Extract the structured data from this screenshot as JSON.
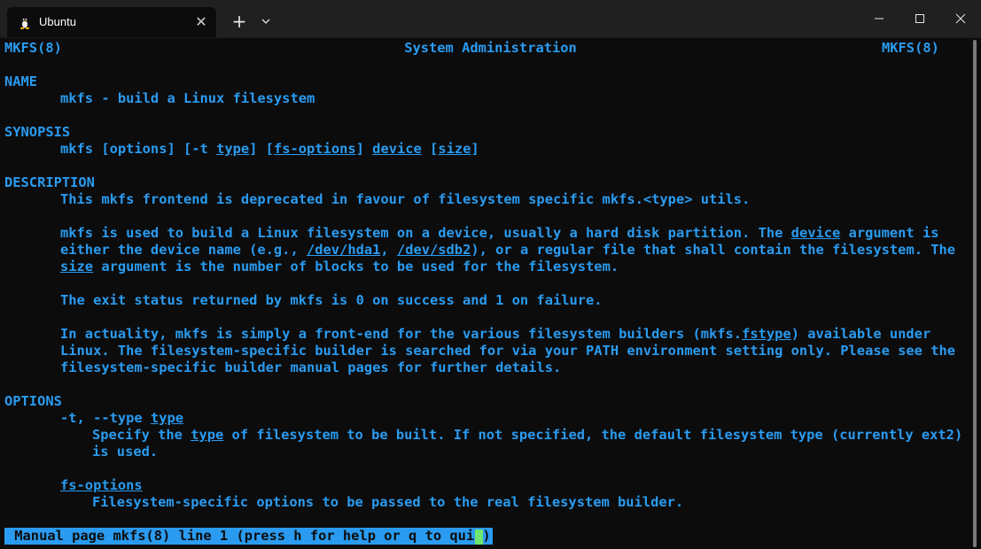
{
  "window": {
    "tab_title": "Ubuntu",
    "tab_icon": "linux-penguin-icon",
    "new_tab": "+",
    "tab_close": "✕"
  },
  "man": {
    "header_left": "MKFS(8)",
    "header_center": "System Administration",
    "header_right": "MKFS(8)",
    "name_heading": "NAME",
    "name_line": "mkfs - build a Linux filesystem",
    "synopsis_heading": "SYNOPSIS",
    "synopsis": {
      "cmd": "mkfs [options] [-t ",
      "type": "type",
      "mid1": "] [",
      "fs_options": "fs-options",
      "mid2": "] ",
      "device": "device",
      "mid3": " [",
      "size": "size",
      "end": "]"
    },
    "description_heading": "DESCRIPTION",
    "desc_p1": "This mkfs frontend is deprecated in favour of filesystem specific mkfs.<type> utils.",
    "desc_p2": {
      "l1_a": "mkfs is used to build a Linux filesystem on a device, usually a hard disk partition. The ",
      "l1_device": "device",
      "l1_b": " argument is",
      "l2_a": "either the device name (e.g., ",
      "l2_hda1": "/dev/hda1",
      "l2_b": ", ",
      "l2_sdb2": "/dev/sdb2",
      "l2_c": "), or a regular file that shall contain the filesystem. The",
      "l3_size": "size",
      "l3_b": " argument is the number of blocks to be used for the filesystem."
    },
    "desc_p3": "The exit status returned by mkfs is 0 on success and 1 on failure.",
    "desc_p4": {
      "l1_a": "In actuality, mkfs is simply a front-end for the various filesystem builders (mkfs.",
      "l1_fstype": "fstype",
      "l1_b": ") available under",
      "l2": "Linux. The filesystem-specific builder is searched for via your PATH environment setting only. Please see the",
      "l3": "filesystem-specific builder manual pages for further details."
    },
    "options_heading": "OPTIONS",
    "opt_t": {
      "flag": "-t, --type ",
      "arg": "type",
      "d1_a": "Specify the ",
      "d1_type": "type",
      "d1_b": " of filesystem to be built. If not specified, the default filesystem type (currently ext2)",
      "d2": "is used."
    },
    "opt_fs": {
      "name": "fs-options",
      "desc": "Filesystem-specific options to be passed to the real filesystem builder."
    },
    "status": " Manual page mkfs(8) line 1 (press h for help or q to quit)"
  },
  "colors": {
    "background": "#0c0c0c",
    "text": "#2a9bf0",
    "cursor": "#6fe66f",
    "titlebar": "#202020"
  }
}
